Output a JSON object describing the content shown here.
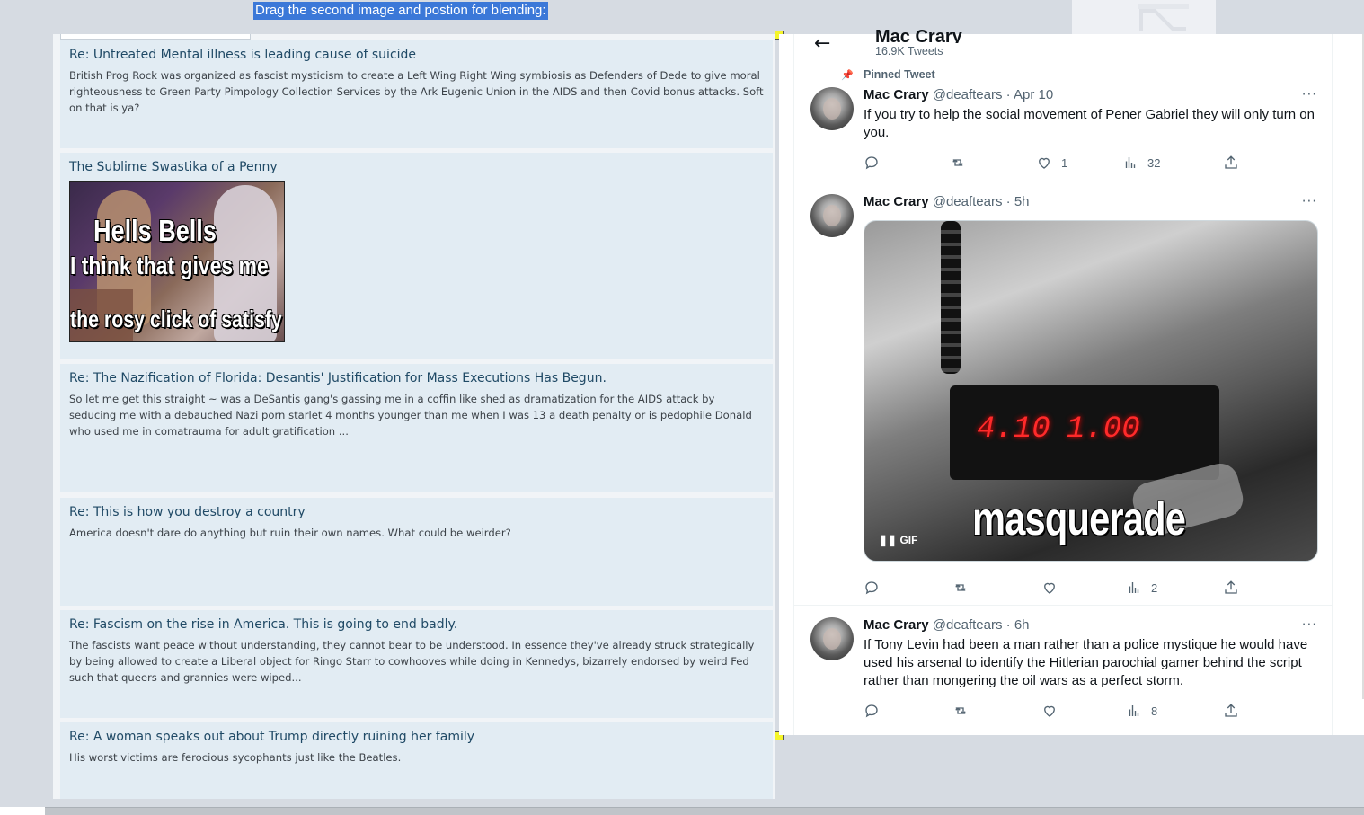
{
  "instruction": "Drag the second image and postion for blending:",
  "feed": {
    "posts": [
      {
        "title": "Re: Untreated Mental illness is leading cause of suicide",
        "body": "British Prog Rock was organized as fascist mysticism to create a Left Wing Right Wing symbiosis as Defenders of Dede to give moral righteousness to Green Party Pimpology Collection Services by the Ark Eugenic Union in the AIDS and then Covid bonus attacks. Soft on that is ya?"
      },
      {
        "title": "The Sublime Swastika of a Penny",
        "meme_lines": [
          "Hells Bells",
          "I think that gives me",
          "the rosy click of satisfy"
        ]
      },
      {
        "title": "Re: The Nazification of Florida: Desantis' Justification for Mass Executions Has Begun.",
        "body": "So let me get this straight ~ was a DeSantis gang's gassing me in a coffin like shed as dramatization for the AIDS attack by seducing me with a debauched Nazi porn starlet 4 months younger than me when I was 13 a death penalty or is pedophile Donald who used me in comatrauma for adult gratification ..."
      },
      {
        "title": "Re: This is how you destroy a country",
        "body": "America doesn't dare do anything but ruin their own names. What could be weirder?"
      },
      {
        "title": "Re: Fascism on the rise in America. This is going to end badly.",
        "body": "The fascists want peace without understanding, they cannot bear to be understood. In essence they've already struck strategically by being allowed to create a Liberal object for Ringo Starr to cowhooves while doing in Kennedys, bizarrely endorsed by weird Fed such that queers and grannies were wiped..."
      },
      {
        "title": "Re: A woman speaks out about Trump directly ruining her family",
        "body": "His worst victims are ferocious sycophants just like the Beatles."
      }
    ]
  },
  "twitter": {
    "profile_name": "Mac Crary",
    "tweet_count": "16.9K Tweets",
    "pinned_label": "Pinned Tweet",
    "tweets": [
      {
        "name": "Mac Crary",
        "handle": "@deaftears · Apr 10",
        "text": "If you try to help the social movement of Pener Gabriel they will only turn on you.",
        "likes": "1",
        "views": "32"
      },
      {
        "name": "Mac Crary",
        "handle": "@deaftears · 5h",
        "media_caption": "masquerade",
        "meter_left": "4.10",
        "meter_right": "1.00",
        "gif_badge": "GIF",
        "views": "2"
      },
      {
        "name": "Mac Crary",
        "handle": "@deaftears · 6h",
        "text": "If Tony Levin had been a man rather than a police mystique he would have used his arsenal to identify the Hitlerian parochial gamer behind the script rather than mongering the oil wars as a perfect storm.",
        "views": "8"
      }
    ]
  },
  "icons": [
    "back-arrow-icon",
    "pin-icon",
    "reply-icon",
    "retweet-icon",
    "like-icon",
    "views-icon",
    "share-icon",
    "more-icon",
    "pause-icon"
  ]
}
